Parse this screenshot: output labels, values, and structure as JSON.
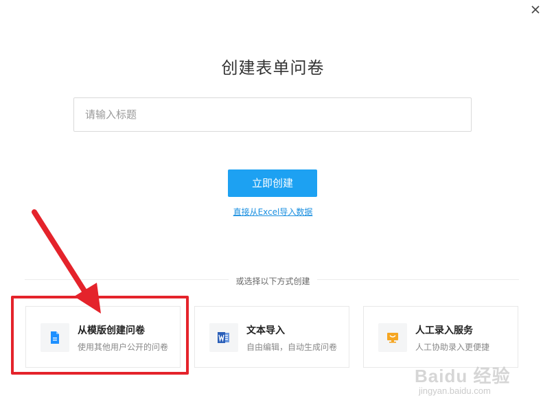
{
  "dialog": {
    "title": "创建表单问卷",
    "close_icon": "close-icon",
    "title_input": {
      "placeholder": "请输入标题",
      "value": ""
    },
    "create_button": "立即创建",
    "excel_link": "直接从Excel导入数据",
    "divider_text": "或选择以下方式创建"
  },
  "options": [
    {
      "icon": "document-icon",
      "title": "从模版创建问卷",
      "subtitle": "使用其他用户公开的问卷",
      "icon_color": "#1e90ff"
    },
    {
      "icon": "word-icon",
      "title": "文本导入",
      "subtitle": "自由编辑，自动生成问卷",
      "icon_color": "#2b5fb8"
    },
    {
      "icon": "service-icon",
      "title": "人工录入服务",
      "subtitle": "人工协助录入更便捷",
      "icon_color": "#f5a623"
    }
  ],
  "annotation": {
    "highlight_color": "#e4232b"
  },
  "watermark": {
    "brand": "Baidu 经验",
    "url": "jingyan.baidu.com"
  }
}
